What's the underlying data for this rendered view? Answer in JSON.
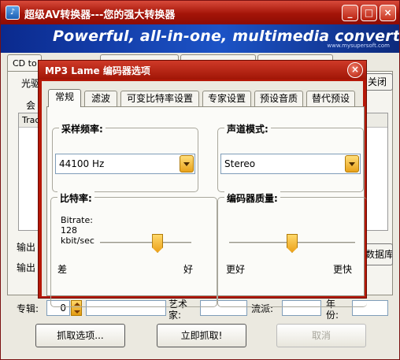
{
  "main": {
    "title": "超级AV转换器---您的强大转换器",
    "minimize_label": "_",
    "maximize_label": "□",
    "close_label": "×",
    "banner_text": "Powerful, all-in-one, multimedia converter!",
    "banner_url": "www.mysupersoft.com",
    "tabs": [
      "CD to"
    ],
    "drive_label": "光驱",
    "close_tray_label": "关闭",
    "group_label": "会",
    "track_header": "Trac",
    "output_dir_label": "输出",
    "output_fmt_label": "输出",
    "db_label": "数据库",
    "album_label": "专辑:",
    "album_value": "0",
    "artist_label": "艺术家:",
    "genre_label": "流派:",
    "year_label": "年份:",
    "rip_options_label": "抓取选项...",
    "rip_now_label": "立即抓取!",
    "cancel_label": "取消"
  },
  "dialog": {
    "title": "MP3 Lame 编码器选项",
    "close_label": "×",
    "tabs": [
      "常规",
      "滤波",
      "可变比特率设置",
      "专家设置",
      "预设音质",
      "替代预设"
    ],
    "active_tab": 0,
    "sample_rate": {
      "title": "采样频率:",
      "value": "44100 Hz"
    },
    "channel_mode": {
      "title": "声道模式:",
      "value": "Stereo"
    },
    "bitrate": {
      "title": "比特率:",
      "caption_line1": "Bitrate:",
      "caption_line2": "128",
      "caption_line3": "kbit/sec",
      "min_label": "差",
      "max_label": "好",
      "position": 0.63
    },
    "quality": {
      "title": "编码器质量:",
      "min_label": "更好",
      "max_label": "更快",
      "position": 0.5
    }
  },
  "colors": {
    "titlebar": "#a41408",
    "banner": "#1c53c6",
    "thumb": "#eba11a"
  }
}
